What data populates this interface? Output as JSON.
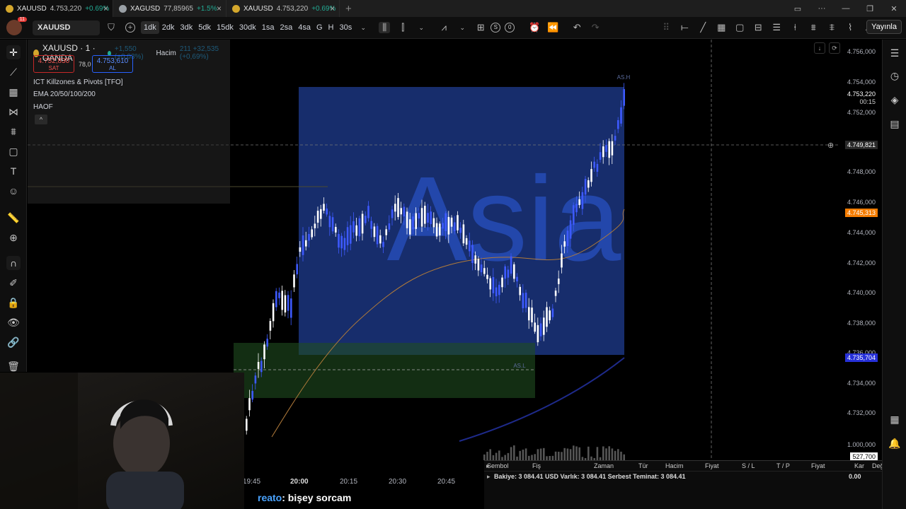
{
  "tabs": [
    {
      "symbol": "XAUUSD",
      "price": "4.753,220",
      "change": "+0.69%",
      "close": "×",
      "coin": "gold"
    },
    {
      "symbol": "XAGUSD",
      "price": "77,85965",
      "change": "+1.5%",
      "close": "×",
      "coin": "silver"
    },
    {
      "symbol": "XAUUSD",
      "price": "4.753,220",
      "change": "+0.69%",
      "close": "×",
      "coin": "gold"
    }
  ],
  "new_tab": "+",
  "window_controls": {
    "min": "—",
    "max": "❐",
    "close": "✕"
  },
  "toolbar": {
    "notification_count": "11",
    "symbol": "XAUUSD",
    "intervals": [
      "1dk",
      "2dk",
      "3dk",
      "5dk",
      "15dk",
      "30dk",
      "1sa",
      "2sa",
      "4sa",
      "G",
      "H",
      "30s"
    ],
    "selected_interval": "1dk",
    "seconds_badge": "S",
    "zero_badge": "0",
    "publish_label": "Yayınla"
  },
  "legend": {
    "title": "XAUUSD · 1 · OANDA",
    "change": "+1,550 (+0,03%)",
    "volume_label": "Hacim",
    "volume_value": "211 +32,535 (+0,69%)",
    "sell_price": "4.752,830",
    "sell_label": "SAT",
    "spread": "78,0",
    "buy_price": "4.753,610",
    "buy_label": "AL",
    "indicators": [
      "ICT Killzones & Pivots [TFO]",
      "EMA 20/50/100/200",
      "HAOF"
    ],
    "collapse": "^"
  },
  "chart_overlay": {
    "session_label": "Asia",
    "session_tag": "AS.H",
    "low_tag": "AS.L"
  },
  "price_scale": {
    "ticks": [
      "4.756,000",
      "4.754,000",
      "4.752,000",
      "4.748,000",
      "4.746,000",
      "4.744,000",
      "4.742,000",
      "4.740,000",
      "4.738,000",
      "4.736,000",
      "4.734,000",
      "4.732,000",
      "1.000,000"
    ],
    "current_price": "4.753,220",
    "countdown": "00:15",
    "crosshair_price": "4.749,821",
    "orange_tag": "4.745,313",
    "blue_tag": "4.735,704",
    "volume_tag": "527,700"
  },
  "time_axis": [
    "19:45",
    "20:00",
    "20:15",
    "20:30",
    "20:45"
  ],
  "trading_panel": {
    "columns": [
      "Sembol",
      "Fiş",
      "Zaman",
      "Tür",
      "Hacim",
      "Fiyat",
      "S / L",
      "T / P",
      "Fiyat",
      "Kar",
      "Değişim"
    ],
    "balance_line": "Bakiye: 3 084.41 USD  Varlık: 3 084.41  Serbest Teminat: 3 084.41",
    "profit": "0.00"
  },
  "chat": {
    "user": "reato",
    "message": ": bişey sorcam"
  },
  "colors": {
    "up": "#22ab94",
    "down": "#ef5350",
    "candle": "#2962ff",
    "session_box": "#1e3a8a",
    "orange": "#f57c00"
  }
}
